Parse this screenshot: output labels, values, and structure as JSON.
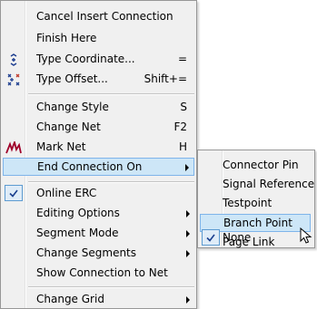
{
  "main_menu": {
    "items": [
      {
        "label": "Cancel Insert Connection",
        "shortcut": ""
      },
      {
        "label": "Finish Here",
        "shortcut": ""
      },
      {
        "label": "Type Coordinate...",
        "shortcut": "=",
        "icon": "coordinate-icon"
      },
      {
        "label": "Type Offset...",
        "shortcut": "Shift+=",
        "icon": "offset-icon"
      },
      {
        "label": "Change Style",
        "shortcut": "S"
      },
      {
        "label": "Change Net",
        "shortcut": "F2"
      },
      {
        "label": "Mark Net",
        "shortcut": "H",
        "icon": "mark-net-icon"
      },
      {
        "label": "End Connection On",
        "submenu": true,
        "state": "highlighted"
      },
      {
        "label": "Online ERC",
        "checked": true
      },
      {
        "label": "Editing Options",
        "submenu": true
      },
      {
        "label": "Segment Mode",
        "submenu": true
      },
      {
        "label": "Change Segments",
        "submenu": true
      },
      {
        "label": "Show Connection to Net"
      },
      {
        "label": "Change Grid",
        "submenu": true
      }
    ]
  },
  "sub_menu": {
    "items": [
      {
        "label": "Connector Pin"
      },
      {
        "label": "Signal Reference"
      },
      {
        "label": "Testpoint"
      },
      {
        "label": "Branch Point",
        "state": "highlighted"
      },
      {
        "label": "Page Link"
      },
      {
        "label": "None",
        "checked": true
      }
    ]
  },
  "colors": {
    "highlight_bg": "#cde6f7",
    "highlight_border": "#7eb4ea",
    "menu_bg": "#f0f0f0",
    "check_border": "#5d9bd1",
    "mark_net_icon": "#a0002a"
  }
}
